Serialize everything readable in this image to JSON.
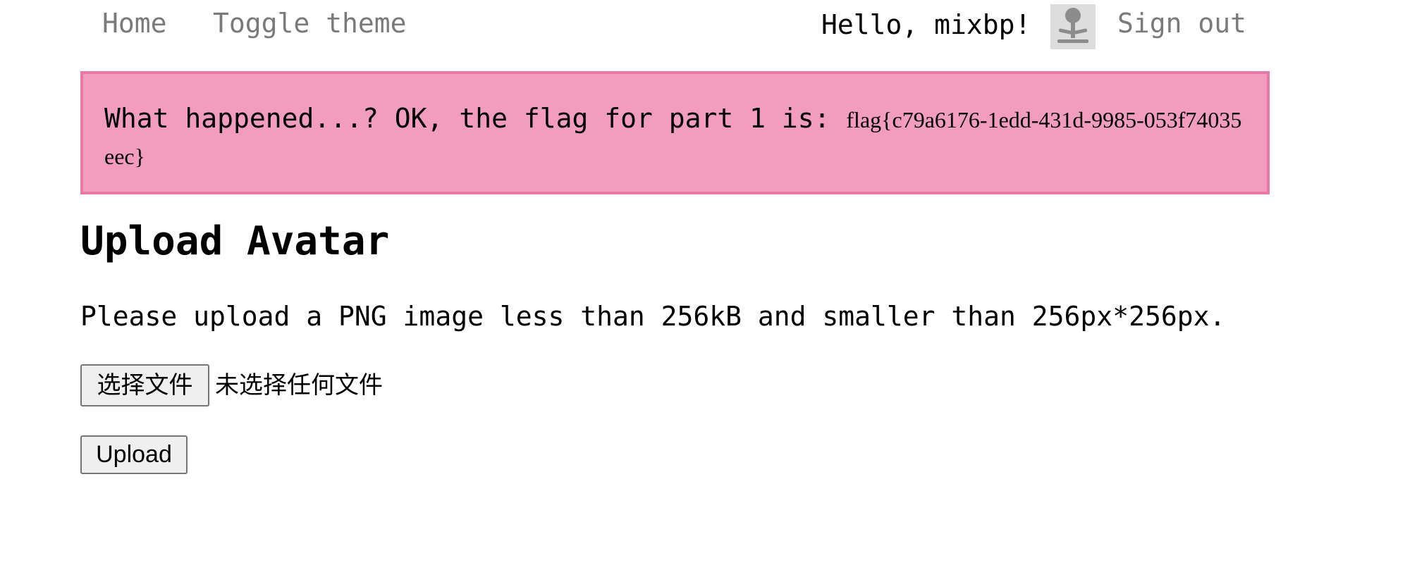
{
  "nav": {
    "home": "Home",
    "toggle_theme": "Toggle theme",
    "greeting": "Hello, mixbp!",
    "sign_out": "Sign out",
    "avatar_icon": "user-avatar-icon"
  },
  "alert": {
    "message": "What happened...? OK, the flag for part 1 is: ",
    "flag": "flag{c79a6176-1edd-431d-9985-053f74035eec}",
    "background": "#f29dbe",
    "border": "#ea78a6"
  },
  "main": {
    "title": "Upload Avatar",
    "instructions": "Please upload a PNG image less than 256kB and smaller than 256px*256px.",
    "choose_file_label": "选择文件",
    "no_file_text": "未选择任何文件",
    "upload_label": "Upload"
  }
}
